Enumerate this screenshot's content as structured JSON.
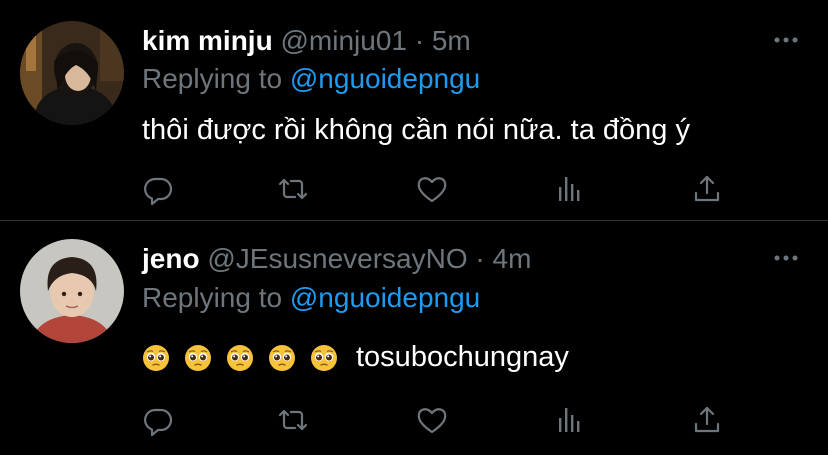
{
  "tweets": [
    {
      "name": "kim minju",
      "handle": "@minju01",
      "separator": "·",
      "time": "5m",
      "replying_label": "Replying to",
      "replying_to": "@nguoidepngu",
      "text": "thôi được rồi không cần nói nữa. ta đồng ý",
      "emojis": []
    },
    {
      "name": "jeno",
      "handle": "@JEsusneversayNO",
      "separator": "·",
      "time": "4m",
      "replying_label": "Replying to",
      "replying_to": "@nguoidepngu",
      "text": "tosubochungnay",
      "emojis": [
        "pleading-face",
        "pleading-face",
        "pleading-face",
        "pleading-face",
        "pleading-face"
      ]
    }
  ],
  "colors": {
    "background": "#000000",
    "muted": "#6e767d",
    "link": "#1d9bf0",
    "divider": "#2f3336"
  },
  "icons": [
    "more-icon",
    "reply-icon",
    "retweet-icon",
    "like-icon",
    "analytics-icon",
    "share-icon"
  ]
}
